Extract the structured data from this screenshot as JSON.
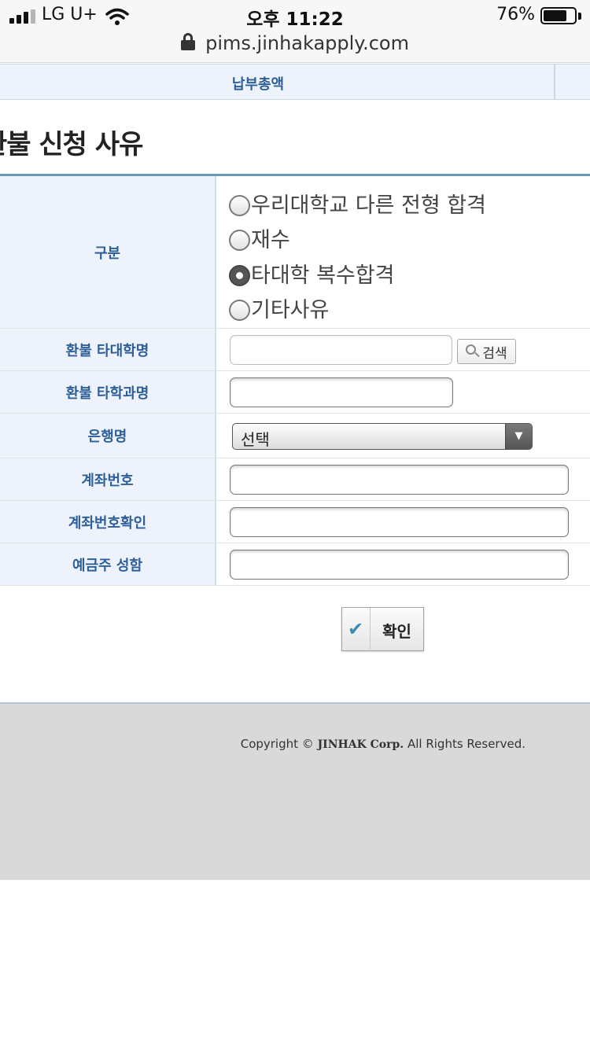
{
  "status_bar": {
    "carrier": "LG U+",
    "time": "오후 11:22",
    "battery_percent": "76%",
    "battery_level": 0.76,
    "signal_bars": 3,
    "signal_bars_total": 4
  },
  "browser": {
    "url": "pims.jinhakapply.com"
  },
  "summary": {
    "total_label": "납부총액"
  },
  "section": {
    "title": "환불 신청 사유"
  },
  "form": {
    "category": {
      "label": "구분",
      "options": [
        {
          "label": "우리대학교 다른 전형 합격",
          "checked": false
        },
        {
          "label": "재수",
          "checked": false
        },
        {
          "label": "타대학 복수합격",
          "checked": true
        },
        {
          "label": "기타사유",
          "checked": false
        }
      ]
    },
    "other_university": {
      "label": "환불 타대학명",
      "value": "",
      "search_label": "검색"
    },
    "other_department": {
      "label": "환불 타학과명",
      "value": ""
    },
    "bank": {
      "label": "은행명",
      "selected": "선택"
    },
    "account_number": {
      "label": "계좌번호",
      "value": ""
    },
    "account_confirm": {
      "label": "계좌번호확인",
      "value": ""
    },
    "account_holder": {
      "label": "예금주 성함",
      "value": ""
    },
    "confirm_label": "확인"
  },
  "footer": {
    "copyright_prefix": "Copyright ©",
    "company": "JINHAK Corp.",
    "rights": "All Rights Reserved."
  },
  "colors": {
    "header_bg": "#eef3fb",
    "label_text": "#2d5f9a",
    "table_top_border": "#6a9bb3",
    "footer_bg": "#d9d9d9",
    "check_accent": "#3a8db0"
  },
  "icons": [
    "lock-icon",
    "wifi-icon",
    "battery-icon",
    "signal-icon",
    "search-icon",
    "dropdown-arrow-icon",
    "check-icon"
  ]
}
